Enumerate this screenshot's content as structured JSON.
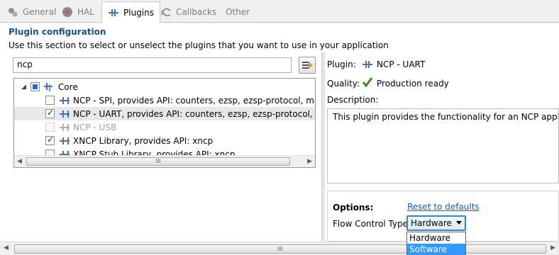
{
  "tabs": [
    {
      "label": "General",
      "icon": "general-icon",
      "active": false
    },
    {
      "label": "HAL",
      "icon": "hal-icon",
      "active": false
    },
    {
      "label": "Plugins",
      "icon": "plugin-icon",
      "active": true
    },
    {
      "label": "Callbacks",
      "icon": "callbacks-icon",
      "active": false
    },
    {
      "label": "Other",
      "icon": "",
      "active": false
    }
  ],
  "section": {
    "title": "Plugin configuration",
    "description": "Use this section to select or unselect the plugins that you want to use in your application"
  },
  "filter": {
    "value": "ncp"
  },
  "tree": {
    "root": "Core",
    "items": [
      {
        "label": "NCP - SPI, provides API: counters, ezsp, ezsp-protocol, main, ncp,",
        "checked": false,
        "disabled": false,
        "selected": false
      },
      {
        "label": "NCP - UART, provides API: counters, ezsp, ezsp-protocol, main, n",
        "checked": true,
        "disabled": false,
        "selected": true
      },
      {
        "label": "NCP - USB",
        "checked": false,
        "disabled": true,
        "selected": false
      },
      {
        "label": "XNCP Library, provides API: xncp",
        "checked": true,
        "disabled": false,
        "selected": false
      },
      {
        "label": "XNCP Stub Library, provides API: xncp",
        "checked": false,
        "disabled": false,
        "selected": false
      }
    ]
  },
  "details": {
    "plugin_label": "Plugin:",
    "plugin_name": "NCP - UART",
    "quality_label": "Quality:",
    "quality_value": "Production ready",
    "description_label": "Description:",
    "description_text": "This plugin provides the functionality for an NCP application"
  },
  "options": {
    "label": "Options:",
    "reset_link": "Reset to defaults",
    "flow_control_label": "Flow Control Type:",
    "flow_control_value": "Hardware",
    "flow_control_options": [
      "Hardware",
      "Software"
    ],
    "highlighted_option": "Software"
  },
  "scroll_grip": "III",
  "colors": {
    "title": "#1c4f85",
    "link": "#0a5ec9",
    "highlight": "#3399ff",
    "select_border": "#3d7fd1"
  }
}
